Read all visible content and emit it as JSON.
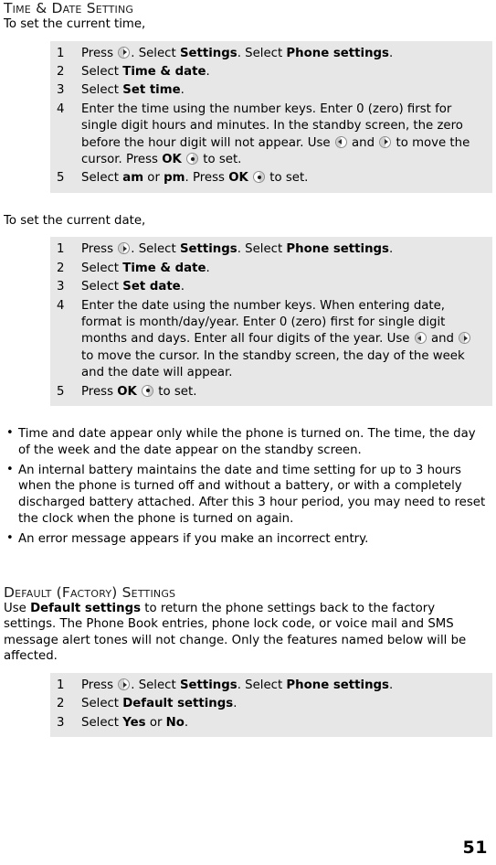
{
  "document": {
    "page_number": "51",
    "table_background": "#e7e7e7"
  },
  "icons": {
    "right_key": "nav-right-key-icon",
    "left_key": "nav-left-key-icon",
    "ok_key": "ok-key-icon"
  },
  "sections": [
    {
      "heading": "Time & Date Setting",
      "intro": "To set the current time,",
      "steps": [
        {
          "num": "1",
          "parts": [
            {
              "t": "Press ",
              "b": false
            },
            {
              "t": "",
              "icon": "right_key"
            },
            {
              "t": ". Select  ",
              "b": false
            },
            {
              "t": "Settings",
              "b": true
            },
            {
              "t": ". Select  ",
              "b": false
            },
            {
              "t": "Phone settings",
              "b": true
            },
            {
              "t": ".",
              "b": false
            }
          ]
        },
        {
          "num": "2",
          "parts": [
            {
              "t": "Select  ",
              "b": false
            },
            {
              "t": "Time & date",
              "b": true
            },
            {
              "t": ".",
              "b": false
            }
          ]
        },
        {
          "num": "3",
          "parts": [
            {
              "t": "Select  ",
              "b": false
            },
            {
              "t": "Set time",
              "b": true
            },
            {
              "t": ".",
              "b": false
            }
          ]
        },
        {
          "num": "4",
          "parts": [
            {
              "t": "Enter the time using the number keys. Enter 0 (zero) first for single digit hours and minutes. In the standby screen, the zero before the hour digit will not appear. Use ",
              "b": false
            },
            {
              "t": "",
              "icon": "left_key"
            },
            {
              "t": " and ",
              "b": false
            },
            {
              "t": "",
              "icon": "right_key"
            },
            {
              "t": " to move the cursor. Press ",
              "b": false
            },
            {
              "t": "OK",
              "b": true
            },
            {
              "t": " ",
              "b": false
            },
            {
              "t": "",
              "icon": "ok_key"
            },
            {
              "t": " to set.",
              "b": false
            }
          ]
        },
        {
          "num": "5",
          "parts": [
            {
              "t": "Select  ",
              "b": false
            },
            {
              "t": "am",
              "b": true
            },
            {
              "t": " or  ",
              "b": false
            },
            {
              "t": "pm",
              "b": true
            },
            {
              "t": ". Press ",
              "b": false
            },
            {
              "t": "OK",
              "b": true
            },
            {
              "t": " ",
              "b": false
            },
            {
              "t": "",
              "icon": "ok_key"
            },
            {
              "t": " to set.",
              "b": false
            }
          ]
        }
      ]
    },
    {
      "intro": "To set the current date,",
      "steps": [
        {
          "num": "1",
          "parts": [
            {
              "t": "Press ",
              "b": false
            },
            {
              "t": "",
              "icon": "right_key"
            },
            {
              "t": ". Select  ",
              "b": false
            },
            {
              "t": "Settings",
              "b": true
            },
            {
              "t": ". Select  ",
              "b": false
            },
            {
              "t": "Phone settings",
              "b": true
            },
            {
              "t": ".",
              "b": false
            }
          ]
        },
        {
          "num": "2",
          "parts": [
            {
              "t": "Select  ",
              "b": false
            },
            {
              "t": "Time & date",
              "b": true
            },
            {
              "t": ".",
              "b": false
            }
          ]
        },
        {
          "num": "3",
          "parts": [
            {
              "t": "Select  ",
              "b": false
            },
            {
              "t": "Set date",
              "b": true
            },
            {
              "t": ".",
              "b": false
            }
          ]
        },
        {
          "num": "4",
          "parts": [
            {
              "t": "Enter the date using the number keys. When entering date, format is month/day/year. Enter 0 (zero) first for single digit months and days. Enter all four digits of the year. Use ",
              "b": false
            },
            {
              "t": "",
              "icon": "left_key"
            },
            {
              "t": " and ",
              "b": false
            },
            {
              "t": "",
              "icon": "right_key"
            },
            {
              "t": " to move the cursor. In the standby screen, the day of the week and the date will appear.",
              "b": false
            }
          ]
        },
        {
          "num": "5",
          "parts": [
            {
              "t": "Press ",
              "b": false
            },
            {
              "t": "OK",
              "b": true
            },
            {
              "t": " ",
              "b": false
            },
            {
              "t": "",
              "icon": "ok_key"
            },
            {
              "t": " to set.",
              "b": false
            }
          ]
        }
      ]
    }
  ],
  "notes": [
    "Time and date appear only while the phone is turned on. The time, the day of the week and the date appear on the standby screen.",
    "An internal battery maintains the date and time setting for up to 3 hours when the phone is turned off and without a battery, or with a completely discharged battery attached.  After this 3 hour period, you may need to reset the clock when the phone is turned on again.",
    "An error message appears if you make an incorrect entry."
  ],
  "default_section": {
    "heading": "Default (Factory) Settings",
    "paragraph_parts": [
      {
        "t": "Use  ",
        "b": false
      },
      {
        "t": "Default settings",
        "b": true
      },
      {
        "t": " to return the phone settings back to the factory settings. The Phone Book entries, phone lock code, or voice mail and SMS message alert tones will not change. Only the features named below will be affected.",
        "b": false
      }
    ],
    "steps": [
      {
        "num": "1",
        "parts": [
          {
            "t": "Press ",
            "b": false
          },
          {
            "t": "",
            "icon": "right_key"
          },
          {
            "t": ". Select  ",
            "b": false
          },
          {
            "t": "Settings",
            "b": true
          },
          {
            "t": ". Select  ",
            "b": false
          },
          {
            "t": "Phone settings",
            "b": true
          },
          {
            "t": ".",
            "b": false
          }
        ]
      },
      {
        "num": "2",
        "parts": [
          {
            "t": "Select  ",
            "b": false
          },
          {
            "t": "Default settings",
            "b": true
          },
          {
            "t": ".",
            "b": false
          }
        ]
      },
      {
        "num": "3",
        "parts": [
          {
            "t": "Select  ",
            "b": false
          },
          {
            "t": "Yes",
            "b": true
          },
          {
            "t": " or  ",
            "b": false
          },
          {
            "t": "No",
            "b": true
          },
          {
            "t": ".",
            "b": false
          }
        ]
      }
    ]
  }
}
